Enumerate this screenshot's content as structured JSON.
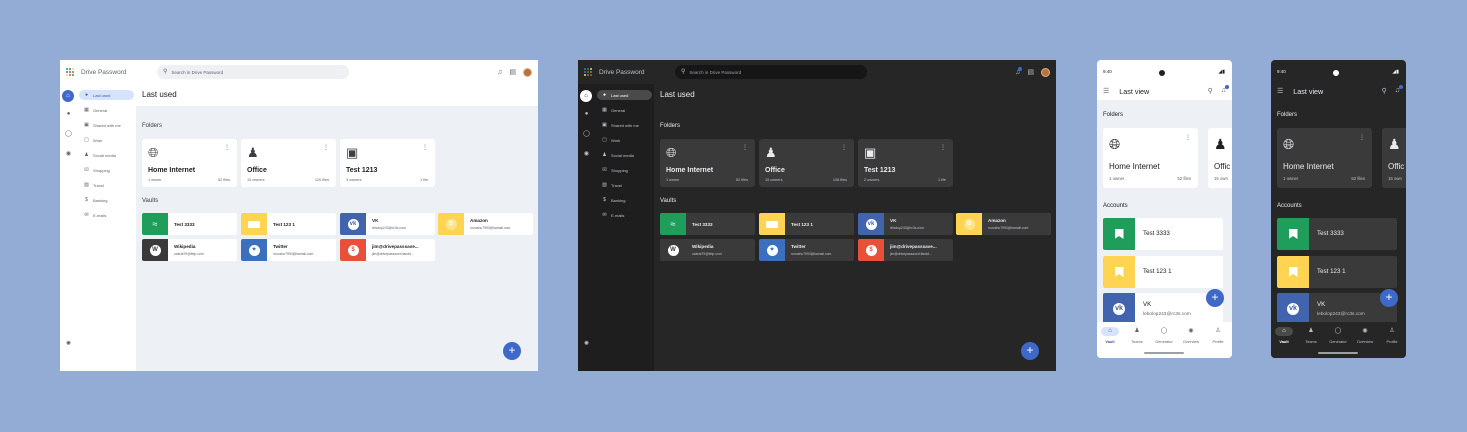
{
  "colors": {
    "background": "#93acd5",
    "accent": "#3f69c8",
    "green": "#1e9e5a",
    "yellow": "#ffd452",
    "vk_blue": "#4263ad",
    "twitter_blue": "#3d6fbf",
    "red": "#e8503a",
    "dark_surface": "#262626"
  },
  "app": {
    "name": "Drive Password",
    "search_placeholder": "Search in Drive Password"
  },
  "nav": [
    {
      "label": "Last used",
      "icon": "clock-icon"
    },
    {
      "label": "General",
      "icon": "grid-icon"
    },
    {
      "label": "Shared with me",
      "icon": "shared-folder-icon"
    },
    {
      "label": "Work",
      "icon": "briefcase-icon"
    },
    {
      "label": "Social media",
      "icon": "people-icon"
    },
    {
      "label": "Shopping",
      "icon": "cart-icon"
    },
    {
      "label": "Travel",
      "icon": "car-icon"
    },
    {
      "label": "Banking",
      "icon": "dollar-icon"
    },
    {
      "label": "E-mails",
      "icon": "mail-icon"
    }
  ],
  "main": {
    "title": "Last used",
    "folders_label": "Folders",
    "vaults_label": "Vaults"
  },
  "folders": [
    {
      "name": "Home Internet",
      "owners": "1 owner",
      "files": "52 files",
      "icon": "globe-icon"
    },
    {
      "name": "Office",
      "owners": "15 owners",
      "files": "120 files",
      "icon": "people-icon"
    },
    {
      "name": "Test 1213",
      "owners": "3 owners",
      "files": "1 file",
      "icon": "folder-icon"
    }
  ],
  "folders_dark": [
    {
      "name": "Home Internet",
      "owners": "1 owner",
      "files": "52 files"
    },
    {
      "name": "Office",
      "owners": "15 owners",
      "files": "108 files"
    },
    {
      "name": "Test 1213",
      "owners": "2 owners",
      "files": "1 file"
    }
  ],
  "vaults": [
    {
      "name": "Test 3333",
      "sub": "",
      "icon": "wifi-icon",
      "color": "#1e9e5a"
    },
    {
      "name": "Test 123 1",
      "sub": "",
      "icon": "card-icon",
      "color": "#ffd452"
    },
    {
      "name": "VK",
      "sub": "lebolop243@rc3s.com",
      "icon": "vk-icon",
      "color": "#4263ad"
    },
    {
      "name": "Amazon",
      "sub": "nurushu7993@kamail.com",
      "icon": "bitcoin-icon",
      "color": "#ffd452"
    },
    {
      "name": "Wikipedia",
      "sub": "uakrat79@firtp.com",
      "icon": "wikipedia-icon",
      "color": "#3a3a3a"
    },
    {
      "name": "Twitter",
      "sub": "nurushu7993@kamail.com",
      "icon": "twitter-icon",
      "color": "#3d6fbf"
    },
    {
      "name": "jim@drivepasssave...",
      "sub": "jim@drivepassword.fandd...",
      "icon": "dollar-icon",
      "color": "#e8503a"
    }
  ],
  "mobile": {
    "time": "9:40",
    "title": "Last view",
    "folders_label": "Folders",
    "accounts_label": "Accounts",
    "folders": [
      {
        "name": "Home Internet",
        "owners": "1 owner",
        "files": "52 files"
      },
      {
        "name": "Offic",
        "owners": "15 own",
        "files": ""
      }
    ],
    "accounts": [
      {
        "name": "Test 3333",
        "sub": ""
      },
      {
        "name": "Test 123 1",
        "sub": ""
      },
      {
        "name": "VK",
        "sub": "lebolop243@rc3s.com"
      }
    ],
    "nav": [
      {
        "label": "Vault",
        "icon": "home-icon"
      },
      {
        "label": "Teams",
        "icon": "people-icon"
      },
      {
        "label": "Generator",
        "icon": "shield-icon"
      },
      {
        "label": "Overview",
        "icon": "eye-icon"
      },
      {
        "label": "Profile",
        "icon": "person-icon"
      }
    ]
  },
  "mobile_dark": {
    "time": "9:40"
  }
}
